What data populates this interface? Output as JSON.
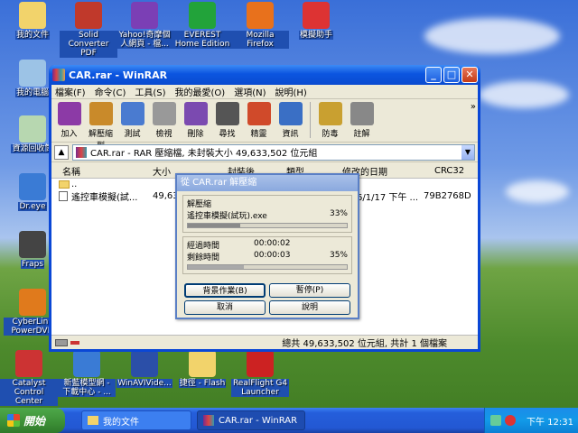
{
  "desktop_icons": [
    {
      "label": "我的文件",
      "icon": "folder-icon",
      "color": "#f2d36b"
    },
    {
      "label": "Solid Converter PDF",
      "icon": "pdf-icon",
      "color": "#c0392b"
    },
    {
      "label": "Yahoo!奇摩個人網頁 - 檔...",
      "icon": "web-icon",
      "color": "#7b3fb5"
    },
    {
      "label": "EVEREST Home Edition",
      "icon": "info-icon",
      "color": "#22a33a"
    },
    {
      "label": "Mozilla Firefox",
      "icon": "firefox-icon",
      "color": "#e8711c"
    },
    {
      "label": "模擬助手",
      "icon": "helper-icon",
      "color": "#d33"
    },
    {
      "label": "我的電腦",
      "icon": "computer-icon",
      "color": "#9cc3e6"
    },
    {
      "label": "資源回收筒",
      "icon": "recycle-bin-icon",
      "color": "#b7d7b0"
    },
    {
      "label": "Dr.eye",
      "icon": "dreye-icon",
      "color": "#3a7bd5"
    },
    {
      "label": "Fraps",
      "icon": "fraps-icon",
      "color": "#444"
    },
    {
      "label": "CyberLink PowerDVD",
      "icon": "dvd-icon",
      "color": "#e07a1c"
    },
    {
      "label": "Catalyst Control Center",
      "icon": "catalyst-icon",
      "color": "#c33"
    },
    {
      "label": "新藍模型網 - 下載中心 - ...",
      "icon": "web-icon",
      "color": "#3a7bd5"
    },
    {
      "label": "WinAVIVide...",
      "icon": "video-icon",
      "color": "#2b4fa8"
    },
    {
      "label": "捷徑 - Flash",
      "icon": "folder-icon",
      "color": "#f2d36b"
    },
    {
      "label": "RealFlight G4 Launcher",
      "icon": "realflight-icon",
      "color": "#c22"
    }
  ],
  "window": {
    "title": "CAR.rar - WinRAR",
    "min": "_",
    "max": "□",
    "close": "✕",
    "menu": [
      "檔案(F)",
      "命令(C)",
      "工具(S)",
      "我的最愛(O)",
      "選項(N)",
      "說明(H)"
    ],
    "tools": [
      {
        "label": "加入",
        "icon": "add-icon",
        "color": "#8c3aa6"
      },
      {
        "label": "解壓縮到",
        "icon": "extract-to-icon",
        "color": "#c98a2a"
      },
      {
        "label": "測試",
        "icon": "test-icon",
        "color": "#4a7bd0"
      },
      {
        "label": "檢視",
        "icon": "view-icon",
        "color": "#999"
      },
      {
        "label": "刪除",
        "icon": "delete-icon",
        "color": "#7b4ab0"
      },
      {
        "label": "尋找",
        "icon": "find-icon",
        "color": "#555"
      },
      {
        "label": "精靈",
        "icon": "wizard-icon",
        "color": "#d04a2a"
      },
      {
        "label": "資訊",
        "icon": "info-icon",
        "color": "#3a6fc5"
      },
      {
        "label": "防毒",
        "icon": "virus-scan-icon",
        "color": "#c9a030"
      },
      {
        "label": "註解",
        "icon": "comment-icon",
        "color": "#888"
      }
    ],
    "more": "»",
    "address": "CAR.rar - RAR 壓縮檔, 未封裝大小 49,633,502 位元組",
    "columns": [
      "名稱",
      "大小",
      "封裝後",
      "類型",
      "修改的日期",
      "CRC32"
    ],
    "rows": [
      {
        "name": "..",
        "size": "",
        "date": "",
        "crc": ""
      },
      {
        "name": "遙控車模擬(試...",
        "size": "49,63",
        "date": "6/1/17 下午 ...",
        "crc": "79B2768D"
      }
    ],
    "status_right": "總共 49,633,502 位元組, 共計 1 個檔案"
  },
  "dialog": {
    "title": "從 CAR.rar 解壓縮",
    "extract_label": "解壓縮",
    "file": "遙控車模擬(試玩).exe",
    "file_pct": "33%",
    "file_progress": 0.33,
    "elapsed_label": "經過時間",
    "elapsed": "00:00:02",
    "remaining_label": "剩餘時間",
    "remaining": "00:00:03",
    "total_pct": "35%",
    "total_progress": 0.35,
    "buttons": {
      "background": "背景作業(B)",
      "pause": "暫停(P)",
      "cancel": "取消",
      "help": "說明"
    }
  },
  "taskbar": {
    "start": "開始",
    "tasks": [
      "我的文件",
      "CAR.rar - WinRAR"
    ],
    "time": "下午 12:31"
  }
}
